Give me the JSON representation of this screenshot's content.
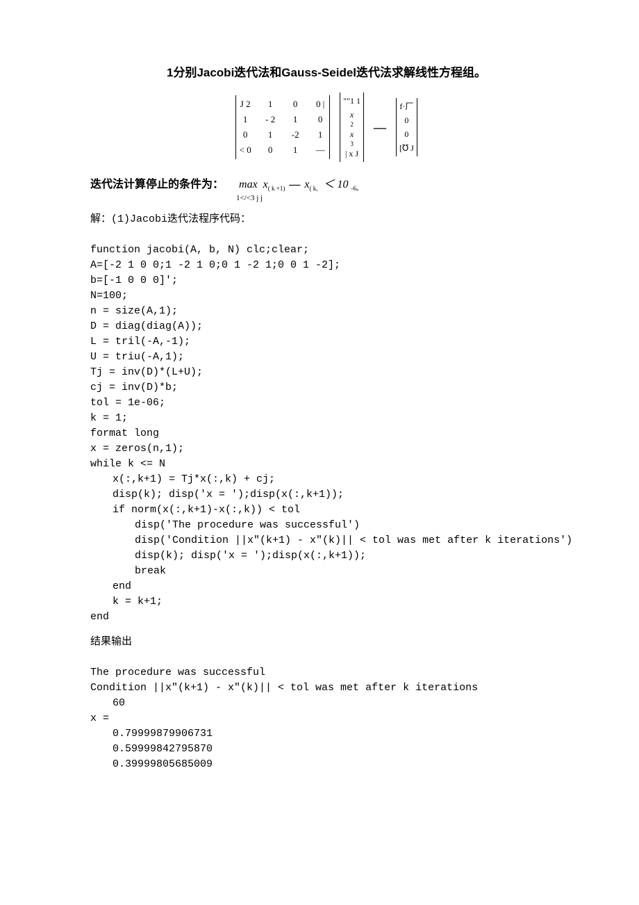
{
  "title": "1分别Jacobi迭代法和Gauss-Seidel迭代法求解线性方程组。",
  "matrix": {
    "A": [
      [
        "J 2",
        "1",
        "0",
        "0 |"
      ],
      [
        "1",
        "- 2",
        "1",
        "0"
      ],
      [
        "0",
        "1",
        "-2",
        "1"
      ],
      [
        "< 0",
        "0",
        "1",
        "—"
      ]
    ],
    "x": [
      "\"\"1 1",
      "x",
      "2",
      "x",
      "3",
      "| x J"
    ],
    "eq": "—",
    "b": [
      "f·厂",
      "0",
      "0",
      "[℧ J"
    ]
  },
  "condition": {
    "prefix": "迭代法计算停止的条件为：",
    "max": "max",
    "expr1": "x",
    "k1": "( k +1)",
    "dash": "—",
    "expr2": "x",
    "k2": "( k,",
    "lt": "＜ 10",
    "neg6": "-6。",
    "sub": "1</<3 j j"
  },
  "section1_label": "解：(1)Jacobi迭代法程序代码：",
  "code_lines": {
    "l1": "function jacobi(A, b, N) clc;clear;",
    "l2": "A=[-2 1 0 0;1 -2 1 0;0 1 -2 1;0 0 1 -2];",
    "l3": "b=[-1 0 0 0]';",
    "l4": "N=100;",
    "l5": "n = size(A,1);",
    "l6": "D = diag(diag(A));",
    "l7": "L = tril(-A,-1);",
    "l8": "U = triu(-A,1);",
    "l9": "Tj = inv(D)*(L+U);",
    "l10": "cj = inv(D)*b;",
    "l11": "tol = 1e-06;",
    "l12": "k = 1;",
    "l13": "format long",
    "l14": "x = zeros(n,1);",
    "l15": "while k <= N",
    "l16": "x(:,k+1) = Tj*x(:,k) + cj;",
    "l17": "disp(k); disp('x = ');disp(x(:,k+1));",
    "l18": "if norm(x(:,k+1)-x(:,k)) < tol",
    "l19": "disp('The procedure was successful')",
    "l20": "disp('Condition ||x\"(k+1) - x\"(k)|| < tol was met after k iterations')",
    "l21": "disp(k); disp('x = ');disp(x(:,k+1));",
    "l22": "break",
    "l23": "end",
    "l24": "k = k+1;",
    "l25": "end"
  },
  "result_label": "结果输出",
  "out_lines": {
    "o1": "The procedure was successful",
    "o2": "Condition ||x\"(k+1) - x\"(k)|| < tol was met after k iterations",
    "o3": "60",
    "o4": "x =",
    "o5": "0.79999879906731",
    "o6": "0.59999842795870",
    "o7": "0.39999805685009"
  }
}
